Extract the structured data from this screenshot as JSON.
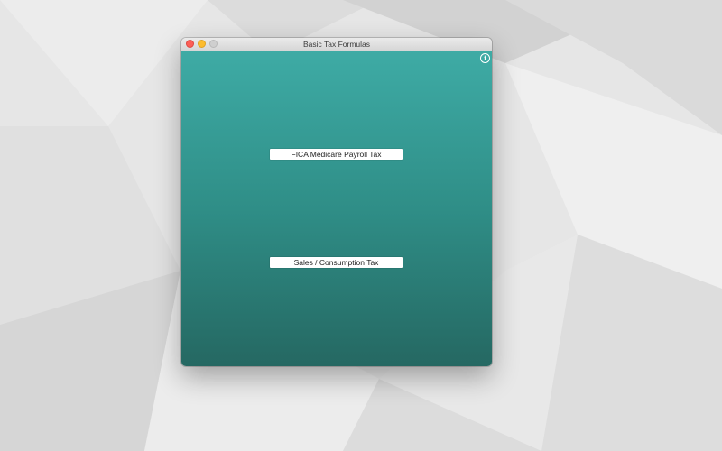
{
  "window": {
    "title": "Basic Tax Formulas"
  },
  "content": {
    "info_icon": "info-icon",
    "buttons": {
      "fica_label": "FICA Medicare Payroll Tax",
      "sales_label": "Sales / Consumption Tax"
    }
  },
  "colors": {
    "gradient_top": "#3eaba5",
    "gradient_bottom": "#256862",
    "close": "#fc5f57",
    "minimize": "#fdbc2e",
    "zoom": "#cfcfcf"
  }
}
